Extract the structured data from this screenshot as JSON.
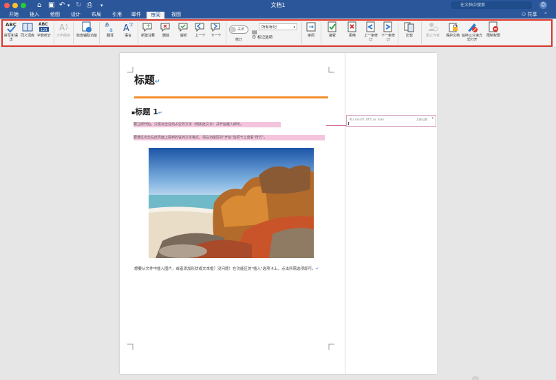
{
  "window": {
    "title": "文档1",
    "search_placeholder": "在文档中搜索",
    "share_label": "共享"
  },
  "colors": {
    "chrome_blue": "#2b579a",
    "ribbon_bg": "#f3f3f3",
    "highlight_frame": "#d9342b",
    "heading_rule": "#f28c28",
    "revision_highlight": "#f3c4dc"
  },
  "menu_tabs": [
    {
      "label": "开始",
      "active": false
    },
    {
      "label": "插入",
      "active": false
    },
    {
      "label": "绘图",
      "active": false
    },
    {
      "label": "设计",
      "active": false
    },
    {
      "label": "布局",
      "active": false
    },
    {
      "label": "引用",
      "active": false
    },
    {
      "label": "邮件",
      "active": false
    },
    {
      "label": "审阅",
      "active": true
    },
    {
      "label": "视图",
      "active": false
    }
  ],
  "ribbon": {
    "spelling": "拼写和语法",
    "thesaurus": "同义词库",
    "word_count": "字数统计",
    "read_aloud": "大声朗读",
    "accessibility": "检查辅助功能",
    "translate": "翻译",
    "language": "语言",
    "new_comment": "新建注释",
    "delete": "删除",
    "resolve": "解析",
    "previous": "上一个",
    "next": "下一个",
    "track_changes": "修订",
    "track_toggle": "关闭",
    "markup_dropdown": "所有标记",
    "markup_options": "标记选项",
    "review_pane": "审阅",
    "accept": "接受",
    "reject": "拒绝",
    "prev_change": "上一条修订",
    "next_change": "下一条修订",
    "compare": "比较",
    "block_authors": "阻止作者",
    "protect": "保护文档",
    "always_read_only": "始终以只读方式打开",
    "restrict": "限制权限"
  },
  "document": {
    "title": "标题",
    "heading1": "标题 1",
    "line1": "要立即开始，只需点击任何占位符文本（例如此文本）并开始键入即可。",
    "line2": "要通过点击在此页面上看到的任何文本格式，请在功能区的\"开始\"选项卡上查看\"样式\"。",
    "paragraph": "想要从文件中插入图片，或者添加形状或文本框？没问题！在功能区的\"插入\"选项卡上，点击所需选项即可。",
    "paragraph_mark": "↵"
  },
  "comment": {
    "author": "Microsoft Office User",
    "time": "几秒以前"
  }
}
